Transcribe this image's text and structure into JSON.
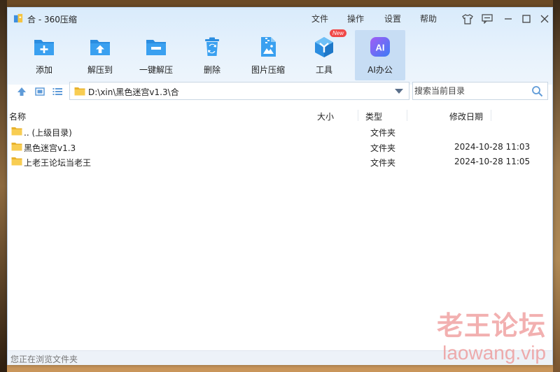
{
  "window": {
    "title": "合 - 360压缩"
  },
  "menu": {
    "file": "文件",
    "operate": "操作",
    "settings": "设置",
    "help": "帮助"
  },
  "toolbar": {
    "add": "添加",
    "extract": "解压到",
    "one_click_extract": "一键解压",
    "delete": "删除",
    "image_compress": "图片压缩",
    "tools": "工具",
    "tools_badge": "New",
    "ai_office": "AI办公",
    "ai_icon_text": "AI"
  },
  "nav": {
    "path": "D:\\xin\\黑色迷宫v1.3\\合",
    "search_placeholder": "搜索当前目录"
  },
  "columns": {
    "name": "名称",
    "size": "大小",
    "type": "类型",
    "modified": "修改日期"
  },
  "files": [
    {
      "name": ".. (上级目录)",
      "type": "文件夹",
      "modified": ""
    },
    {
      "name": "黑色迷宫v1.3",
      "type": "文件夹",
      "modified": "2024-10-28 11:03"
    },
    {
      "name": "上老王论坛当老王",
      "type": "文件夹",
      "modified": "2024-10-28 11:05"
    }
  ],
  "status": {
    "text": "您正在浏览文件夹"
  },
  "watermark": {
    "cn": "老王论坛",
    "url": "laowang.vip"
  },
  "colors": {
    "accent": "#2b8de0",
    "toolbar_bg": "#dcecfb",
    "folder": "#f5c542",
    "badge": "#f04848"
  }
}
